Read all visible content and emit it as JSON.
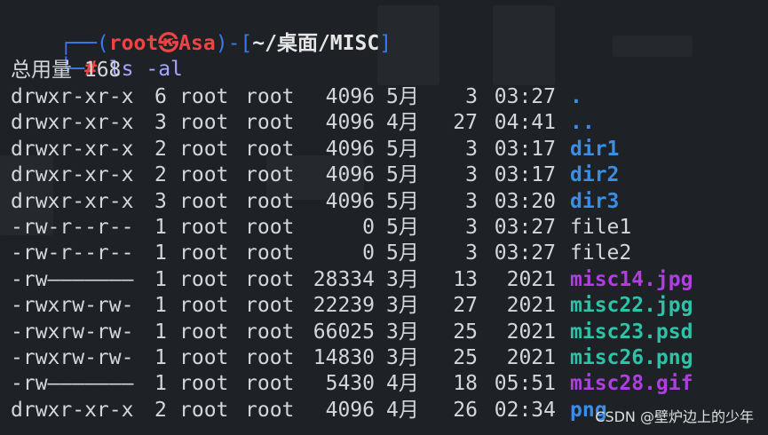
{
  "prompt": {
    "open": "┌──(",
    "user": "root㉿Asa",
    "mid": ")-[",
    "path": "~/桌面/MISC",
    "close": "]",
    "hash_prefix": "└─",
    "hash": "#",
    "command": " ls -al"
  },
  "total_line": "总用量 168",
  "rows": [
    {
      "perm": "drwxr-xr-x",
      "links": "6",
      "owner": "root",
      "group": "root",
      "size": "4096",
      "month": "5月",
      "day": "3",
      "time": "03:27",
      "name": "."
    },
    {
      "perm": "drwxr-xr-x",
      "links": "3",
      "owner": "root",
      "group": "root",
      "size": "4096",
      "month": "4月",
      "day": "27",
      "time": "04:41",
      "name": ".."
    },
    {
      "perm": "drwxr-xr-x",
      "links": "2",
      "owner": "root",
      "group": "root",
      "size": "4096",
      "month": "5月",
      "day": "3",
      "time": "03:17",
      "name": "dir1"
    },
    {
      "perm": "drwxr-xr-x",
      "links": "2",
      "owner": "root",
      "group": "root",
      "size": "4096",
      "month": "5月",
      "day": "3",
      "time": "03:17",
      "name": "dir2"
    },
    {
      "perm": "drwxr-xr-x",
      "links": "3",
      "owner": "root",
      "group": "root",
      "size": "4096",
      "month": "5月",
      "day": "3",
      "time": "03:20",
      "name": "dir3"
    },
    {
      "perm": "-rw-r--r--",
      "links": "1",
      "owner": "root",
      "group": "root",
      "size": "0",
      "month": "5月",
      "day": "3",
      "time": "03:27",
      "name": "file1"
    },
    {
      "perm": "-rw-r--r--",
      "links": "1",
      "owner": "root",
      "group": "root",
      "size": "0",
      "month": "5月",
      "day": "3",
      "time": "03:27",
      "name": "file2"
    },
    {
      "perm": "-rw———————",
      "links": "1",
      "owner": "root",
      "group": "root",
      "size": "28334",
      "month": "3月",
      "day": "13",
      "time": "2021",
      "name": "misc14.jpg"
    },
    {
      "perm": "-rwxrw-rw-",
      "links": "1",
      "owner": "root",
      "group": "root",
      "size": "22239",
      "month": "3月",
      "day": "27",
      "time": "2021",
      "name": "misc22.jpg"
    },
    {
      "perm": "-rwxrw-rw-",
      "links": "1",
      "owner": "root",
      "group": "root",
      "size": "66025",
      "month": "3月",
      "day": "25",
      "time": "2021",
      "name": "misc23.psd"
    },
    {
      "perm": "-rwxrw-rw-",
      "links": "1",
      "owner": "root",
      "group": "root",
      "size": "14830",
      "month": "3月",
      "day": "25",
      "time": "2021",
      "name": "misc26.png"
    },
    {
      "perm": "-rw———————",
      "links": "1",
      "owner": "root",
      "group": "root",
      "size": "5430",
      "month": "4月",
      "day": "18",
      "time": "05:51",
      "name": "misc28.gif"
    },
    {
      "perm": "drwxr-xr-x",
      "links": "2",
      "owner": "root",
      "group": "root",
      "size": "4096",
      "month": "4月",
      "day": "26",
      "time": "02:34",
      "name": "png"
    }
  ],
  "watermark": "CSDN @壁炉边上的少年",
  "colors": {
    "background": "#1e2227",
    "directory": "#3a8ee6",
    "restricted_file": "#b03ee0",
    "writable_file": "#2fc2a7",
    "plain_file": "#d4d6d9",
    "prompt_user": "#ef4444",
    "prompt_frame": "#3b78e7"
  }
}
